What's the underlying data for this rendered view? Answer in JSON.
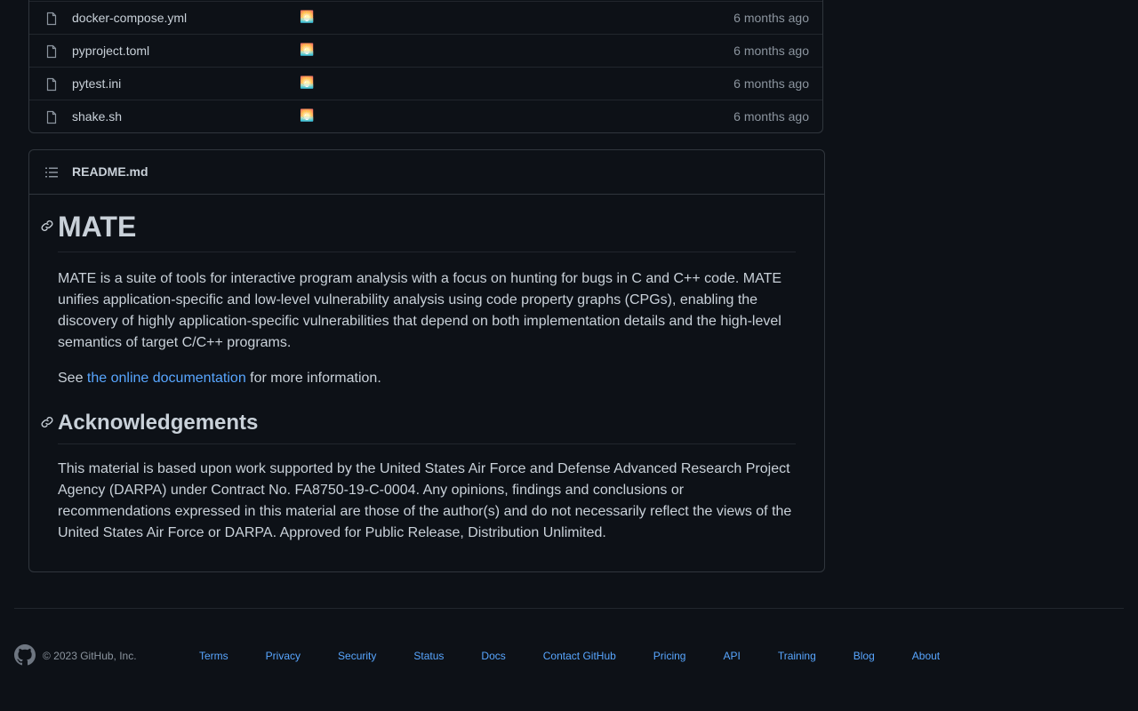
{
  "files": [
    {
      "name": "docker-compose.yml",
      "commit_icon": "sunrise-emoji",
      "age": "6 months ago"
    },
    {
      "name": "pyproject.toml",
      "commit_icon": "sunrise-emoji",
      "age": "6 months ago"
    },
    {
      "name": "pytest.ini",
      "commit_icon": "sunrise-emoji",
      "age": "6 months ago"
    },
    {
      "name": "shake.sh",
      "commit_icon": "sunrise-emoji",
      "age": "6 months ago"
    }
  ],
  "readme": {
    "filename": "README.md",
    "h1": "MATE",
    "intro": "MATE is a suite of tools for interactive program analysis with a focus on hunting for bugs in C and C++ code. MATE unifies application-specific and low-level vulnerability analysis using code property graphs (CPGs), enabling the discovery of highly application-specific vulnerabilities that depend on both implementation details and the high-level semantics of target C/C++ programs.",
    "see_prefix": "See ",
    "see_link": "the online documentation",
    "see_suffix": " for more information.",
    "h2": "Acknowledgements",
    "ack": "This material is based upon work supported by the United States Air Force and Defense Advanced Research Project Agency (DARPA) under Contract No. FA8750-19-C-0004. Any opinions, findings and conclusions or recommendations expressed in this material are those of the author(s) and do not necessarily reflect the views of the United States Air Force or DARPA. Approved for Public Release, Distribution Unlimited."
  },
  "footer": {
    "copyright": "© 2023 GitHub, Inc.",
    "links": [
      "Terms",
      "Privacy",
      "Security",
      "Status",
      "Docs",
      "Contact GitHub",
      "Pricing",
      "API",
      "Training",
      "Blog",
      "About"
    ]
  },
  "colors": {
    "background": "#0d1117",
    "border": "#30363d",
    "text": "#c9d1d9",
    "muted": "#8b949e",
    "link": "#58a6ff"
  }
}
